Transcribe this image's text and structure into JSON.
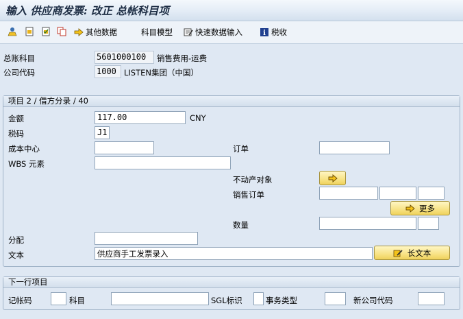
{
  "title": "输入 供应商发票: 改正 总帐科目项",
  "toolbar": {
    "other_data": "其他数据",
    "account_model": "科目模型",
    "fast_entry": "快速数据输入",
    "tax": "税收"
  },
  "header": {
    "gl_account_label": "总账科目",
    "gl_account_value": "5601000100",
    "gl_account_desc": "销售费用-运费",
    "company_code_label": "公司代码",
    "company_code_value": "1000",
    "company_code_desc": "LISTEN集团（中国）"
  },
  "item": {
    "title": "项目 2 / 借方分录 / 40",
    "amount_label": "金额",
    "amount_value": "117.00",
    "currency": "CNY",
    "tax_code_label": "税码",
    "tax_code_value": "J1",
    "cost_center_label": "成本中心",
    "cost_center_value": "",
    "order_label": "订单",
    "order_value": "",
    "wbs_label": "WBS 元素",
    "wbs_value": "",
    "real_estate_label": "不动产对象",
    "sales_order_label": "销售订单",
    "more_button": "更多",
    "quantity_label": "数量",
    "assignment_label": "分配",
    "assignment_value": "",
    "text_label": "文本",
    "text_value": "供应商手工发票录入",
    "long_text_button": "长文本"
  },
  "next": {
    "title": "下一行项目",
    "posting_key_label": "记帐码",
    "account_label": "科目",
    "sgl_label": "SGL标识",
    "trans_type_label": "事务类型",
    "new_company_label": "新公司代码"
  },
  "colors": {
    "background": "#dfe8f3",
    "button": "#f8e48a",
    "title": "#1d2d44"
  }
}
